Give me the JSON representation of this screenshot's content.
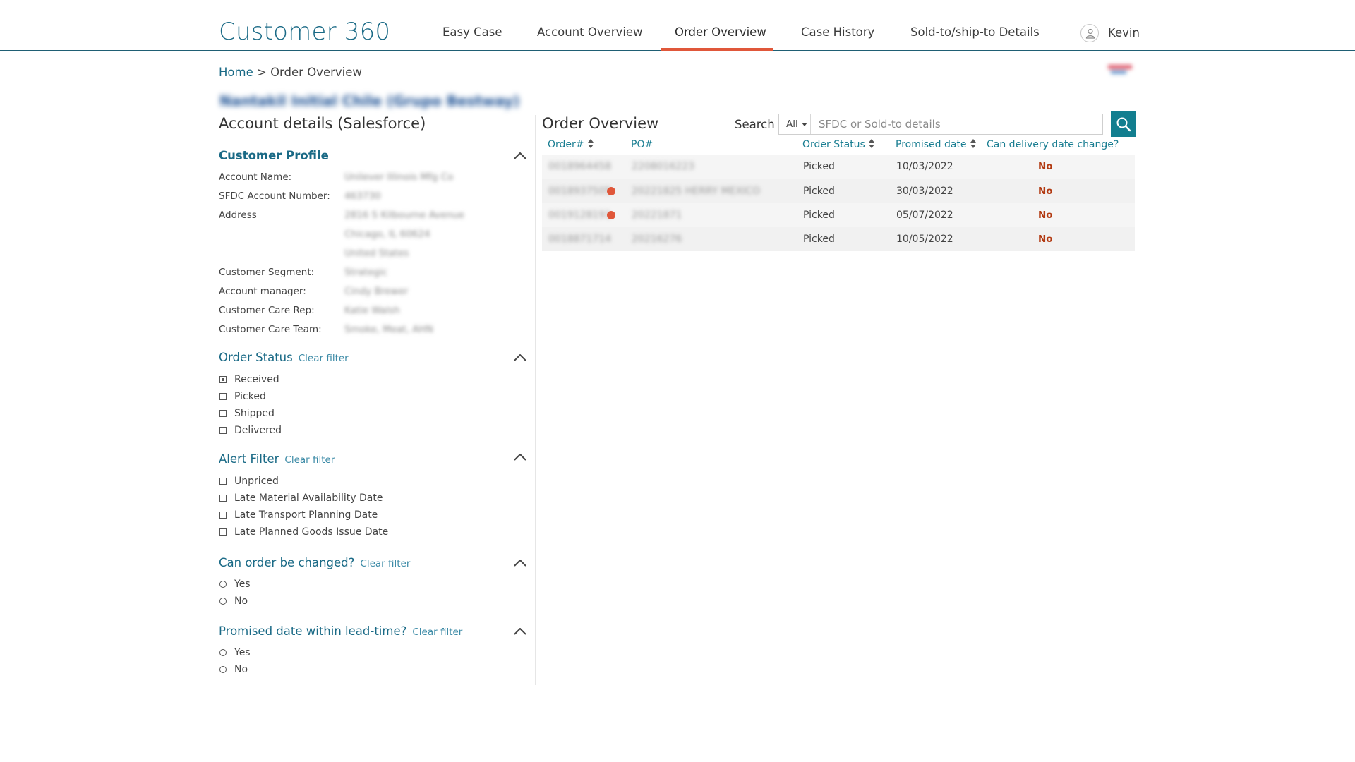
{
  "header": {
    "app_title": "Customer 360",
    "nav": [
      "Easy Case",
      "Account Overview",
      "Order Overview",
      "Case History",
      "Sold-to/ship-to Details"
    ],
    "active_nav": "Order Overview",
    "user_name": "Kevin",
    "accent_color": "#e0573a",
    "brand_color": "#1a6a86"
  },
  "breadcrumb": {
    "home": "Home",
    "separator": ">",
    "current": "Order Overview"
  },
  "account": {
    "blurred_name": "Nantakil Initial Chile (Grupo Bestway)",
    "section_title": "Account details (Salesforce)"
  },
  "customer_profile": {
    "title": "Customer Profile",
    "fields": [
      {
        "label": "Account Name:",
        "value": "Unilever Illinois Mfg Co"
      },
      {
        "label": "SFDC Account Number:",
        "value": "463730"
      },
      {
        "label": "Address",
        "value": "2816 S Kilbourne Avenue"
      },
      {
        "label": "",
        "value": "Chicago, IL 60624"
      },
      {
        "label": "",
        "value": "United States"
      },
      {
        "label": "Customer Segment:",
        "value": "Strategic"
      },
      {
        "label": "Account manager:",
        "value": "Cindy Brewer"
      },
      {
        "label": "Customer Care Rep:",
        "value": "Katie Walsh"
      },
      {
        "label": "Customer Care Team:",
        "value": "Smoke, Meat, AHN"
      }
    ]
  },
  "filters": {
    "clear_label": "Clear filter",
    "order_status": {
      "title": "Order Status",
      "options": [
        {
          "label": "Received",
          "checked": true
        },
        {
          "label": "Picked",
          "checked": false
        },
        {
          "label": "Shipped",
          "checked": false
        },
        {
          "label": "Delivered",
          "checked": false
        }
      ]
    },
    "alert_filter": {
      "title": "Alert Filter",
      "options": [
        "Unpriced",
        "Late Material Availability Date",
        "Late Transport Planning Date",
        "Late Planned Goods Issue Date"
      ]
    },
    "can_order_change": {
      "title": "Can order be changed?",
      "options": [
        "Yes",
        "No"
      ]
    },
    "promised_within_leadtime": {
      "title": "Promised date within lead-time?",
      "options": [
        "Yes",
        "No"
      ]
    }
  },
  "order_overview": {
    "title": "Order Overview",
    "search_label": "Search",
    "search_scope": "All",
    "search_placeholder": "SFDC or Sold-to details",
    "columns": [
      "Order#",
      "PO#",
      "Order Status",
      "Promised date",
      "Can delivery date change?"
    ],
    "rows": [
      {
        "order": "0018964458",
        "po": "2208016223",
        "status": "Picked",
        "promised": "10/03/2022",
        "can_change": "No",
        "alert": false
      },
      {
        "order": "0018937505",
        "po": "20221825 HERRY MEXICO",
        "status": "Picked",
        "promised": "30/03/2022",
        "can_change": "No",
        "alert": true
      },
      {
        "order": "0019128191",
        "po": "20221871",
        "status": "Picked",
        "promised": "05/07/2022",
        "can_change": "No",
        "alert": true
      },
      {
        "order": "0018871714",
        "po": "20216276",
        "status": "Picked",
        "promised": "10/05/2022",
        "can_change": "No",
        "alert": false
      }
    ]
  }
}
